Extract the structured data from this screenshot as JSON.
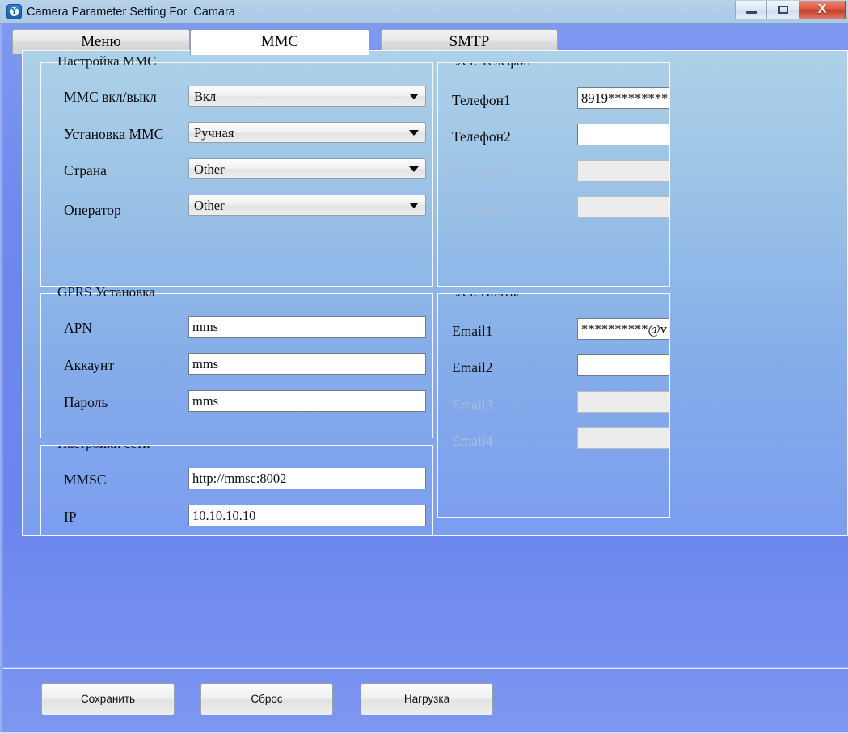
{
  "window": {
    "title": "Camera Parameter Setting For  Camara",
    "icon": "app-logo-icon",
    "logo_glyph": "Y",
    "controls": {
      "minimize": "minimize-icon",
      "maximize": "maximize-icon",
      "close_label": "X"
    }
  },
  "tabs": [
    {
      "label": "Меню",
      "active": false
    },
    {
      "label": "MMC",
      "active": true
    },
    {
      "label": "SMTP",
      "active": false
    }
  ],
  "groups": {
    "mms_settings": {
      "legend": "Настройка MMC",
      "fields": [
        {
          "label": "MMC вкл/выкл",
          "value": "Вкл",
          "control": "combo",
          "disabled": false
        },
        {
          "label": "Установка MMC",
          "value": "Ручная",
          "control": "combo",
          "disabled": false
        },
        {
          "label": "Страна",
          "value": "Other",
          "control": "combo",
          "disabled": false
        },
        {
          "label": "Оператор",
          "value": "Other",
          "control": "combo",
          "disabled": false
        }
      ]
    },
    "phone_settings": {
      "legend": "Уст. Телефон",
      "fields": [
        {
          "label": "Телефон1",
          "value": "8919*********",
          "control": "text",
          "disabled": false
        },
        {
          "label": "Телефон2",
          "value": "",
          "control": "text",
          "disabled": false
        },
        {
          "label": "Телефон3",
          "value": "",
          "control": "text",
          "disabled": true
        },
        {
          "label": "Телефон4",
          "value": "",
          "control": "text",
          "disabled": true
        }
      ]
    },
    "gprs_settings": {
      "legend": "GPRS Установка",
      "fields": [
        {
          "label": "APN",
          "value": "mms",
          "control": "text",
          "disabled": false
        },
        {
          "label": "Аккаунт",
          "value": "mms",
          "control": "text",
          "disabled": false
        },
        {
          "label": "Пароль",
          "value": "mms",
          "control": "text",
          "disabled": false
        }
      ]
    },
    "mail_settings": {
      "legend": "Уст. Почты",
      "fields": [
        {
          "label": "Email1",
          "value": "**********@v",
          "control": "text",
          "disabled": false
        },
        {
          "label": "Email2",
          "value": "",
          "control": "text",
          "disabled": false
        },
        {
          "label": "Email3",
          "value": "",
          "control": "text",
          "disabled": true
        },
        {
          "label": "Email4",
          "value": "",
          "control": "text",
          "disabled": true
        }
      ]
    },
    "network_settings": {
      "legend": "Настройки сети",
      "fields": [
        {
          "label": "MMSC",
          "value": "http://mmsc:8002",
          "control": "text",
          "disabled": false
        },
        {
          "label": "IP",
          "value": "10.10.10.10",
          "control": "text",
          "disabled": false
        }
      ]
    }
  },
  "buttons": {
    "save": "Сохранить",
    "reset": "Сброс",
    "load": "Нагрузка"
  },
  "colors": {
    "window_chrome": "#aecde8",
    "body_blue": "#6b86ee",
    "panel_top": "#aed1e9",
    "close_red": "#c23a26",
    "group_border": "#f4f9fd"
  }
}
